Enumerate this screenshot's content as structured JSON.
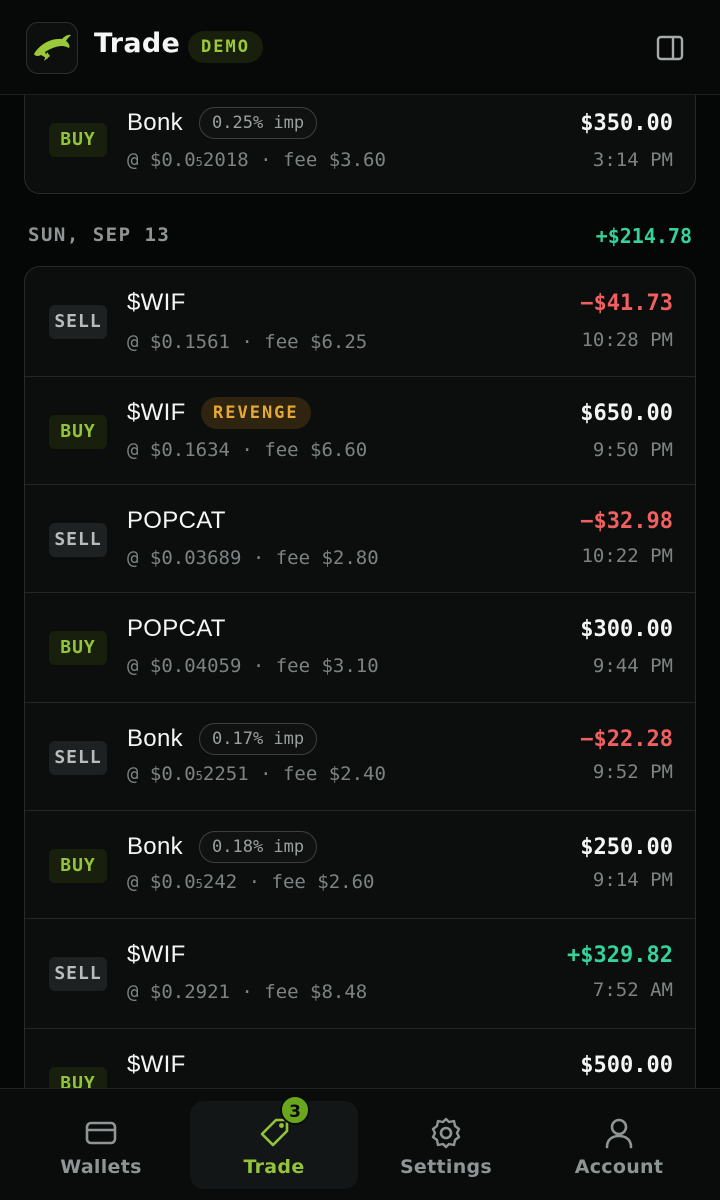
{
  "header": {
    "title": "Trade",
    "badge": "DEMO"
  },
  "top_trade": {
    "side": "BUY",
    "token": "Bonk",
    "tag": "0.25% imp",
    "price_prefix": "@ $0.0",
    "price_sub": "5",
    "price_rest": "2018",
    "fee": "· fee $3.60",
    "amount": "$350.00",
    "time": "3:14 PM"
  },
  "day": {
    "label": "SUN, SEP 13",
    "total": "+$214.78"
  },
  "trades": [
    {
      "side": "SELL",
      "token": "$WIF",
      "tag": "",
      "price": "@ $0.1561",
      "fee": "· fee $6.25",
      "amount": "−$41.73",
      "amount_type": "neg",
      "time": "10:28 PM"
    },
    {
      "side": "BUY",
      "token": "$WIF",
      "tag": "REVENGE",
      "price": "@ $0.1634",
      "fee": "· fee $6.60",
      "amount": "$650.00",
      "amount_type": "neutral",
      "time": "9:50 PM"
    },
    {
      "side": "SELL",
      "token": "POPCAT",
      "tag": "",
      "price": "@ $0.03689",
      "fee": "· fee $2.80",
      "amount": "−$32.98",
      "amount_type": "neg",
      "time": "10:22 PM"
    },
    {
      "side": "BUY",
      "token": "POPCAT",
      "tag": "",
      "price": "@ $0.04059",
      "fee": "· fee $3.10",
      "amount": "$300.00",
      "amount_type": "neutral",
      "time": "9:44 PM"
    },
    {
      "side": "SELL",
      "token": "Bonk",
      "tag": "0.17% imp",
      "price_prefix": "@ $0.0",
      "price_sub": "5",
      "price_rest": "2251",
      "fee": "· fee $2.40",
      "amount": "−$22.28",
      "amount_type": "neg",
      "time": "9:52 PM"
    },
    {
      "side": "BUY",
      "token": "Bonk",
      "tag": "0.18% imp",
      "price_prefix": "@ $0.0",
      "price_sub": "5",
      "price_rest": "242",
      "fee": "· fee $2.60",
      "amount": "$250.00",
      "amount_type": "neutral",
      "time": "9:14 PM"
    },
    {
      "side": "SELL",
      "token": "$WIF",
      "tag": "",
      "price": "@ $0.2921",
      "fee": "· fee $8.48",
      "amount": "+$329.82",
      "amount_type": "pos",
      "time": "7:52 AM"
    },
    {
      "side": "BUY",
      "token": "$WIF",
      "tag": "",
      "price": "",
      "fee": "",
      "amount": "$500.00",
      "amount_type": "neutral",
      "time": ""
    }
  ],
  "nav": {
    "items": [
      {
        "label": "Wallets",
        "icon": "wallet-icon"
      },
      {
        "label": "Trade",
        "icon": "tag-icon",
        "badge": "3"
      },
      {
        "label": "Settings",
        "icon": "gear-icon"
      },
      {
        "label": "Account",
        "icon": "user-icon"
      }
    ]
  },
  "colors": {
    "accent": "#93c43a",
    "positive": "#35d39a",
    "negative": "#f06060",
    "warning": "#e7a834"
  }
}
